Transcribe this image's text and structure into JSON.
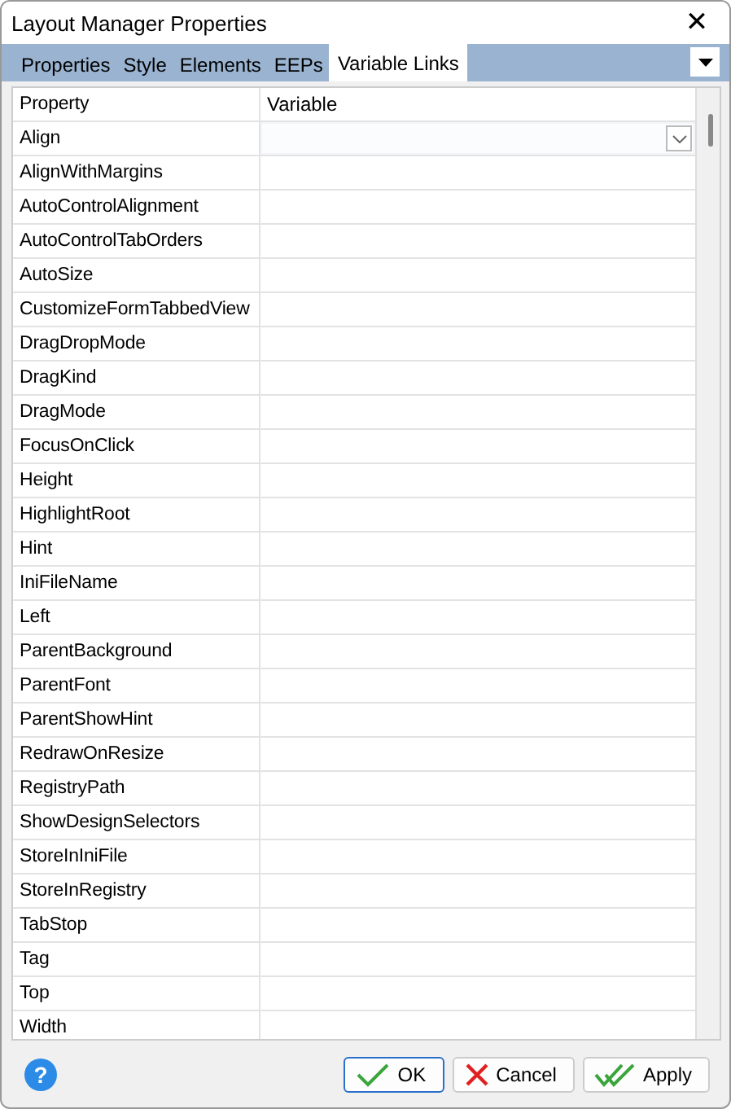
{
  "window": {
    "title": "Layout Manager Properties",
    "close": "✕"
  },
  "tabs": [
    {
      "label": "Properties",
      "selected": false
    },
    {
      "label": "Style",
      "selected": false
    },
    {
      "label": "Elements",
      "selected": false
    },
    {
      "label": "EEPs",
      "selected": false
    },
    {
      "label": "Variable Links",
      "selected": true
    }
  ],
  "table": {
    "columns": [
      "Property",
      "Variable"
    ],
    "rows": [
      {
        "property": "Align",
        "active": true
      },
      {
        "property": "AlignWithMargins",
        "active": false
      },
      {
        "property": "AutoControlAlignment",
        "active": false
      },
      {
        "property": "AutoControlTabOrders",
        "active": false
      },
      {
        "property": "AutoSize",
        "active": false
      },
      {
        "property": "CustomizeFormTabbedView",
        "active": false
      },
      {
        "property": "DragDropMode",
        "active": false
      },
      {
        "property": "DragKind",
        "active": false
      },
      {
        "property": "DragMode",
        "active": false
      },
      {
        "property": "FocusOnClick",
        "active": false
      },
      {
        "property": "Height",
        "active": false
      },
      {
        "property": "HighlightRoot",
        "active": false
      },
      {
        "property": "Hint",
        "active": false
      },
      {
        "property": "IniFileName",
        "active": false
      },
      {
        "property": "Left",
        "active": false
      },
      {
        "property": "ParentBackground",
        "active": false
      },
      {
        "property": "ParentFont",
        "active": false
      },
      {
        "property": "ParentShowHint",
        "active": false
      },
      {
        "property": "RedrawOnResize",
        "active": false
      },
      {
        "property": "RegistryPath",
        "active": false
      },
      {
        "property": "ShowDesignSelectors",
        "active": false
      },
      {
        "property": "StoreInIniFile",
        "active": false
      },
      {
        "property": "StoreInRegistry",
        "active": false
      },
      {
        "property": "TabStop",
        "active": false
      },
      {
        "property": "Tag",
        "active": false
      },
      {
        "property": "Top",
        "active": false
      },
      {
        "property": "Width",
        "active": false
      }
    ]
  },
  "footer": {
    "help": "?",
    "buttons": [
      {
        "label": "OK",
        "kind": "ok",
        "selected": true
      },
      {
        "label": "Cancel",
        "kind": "cancel",
        "selected": false
      },
      {
        "label": "Apply",
        "kind": "apply",
        "selected": false
      }
    ]
  }
}
